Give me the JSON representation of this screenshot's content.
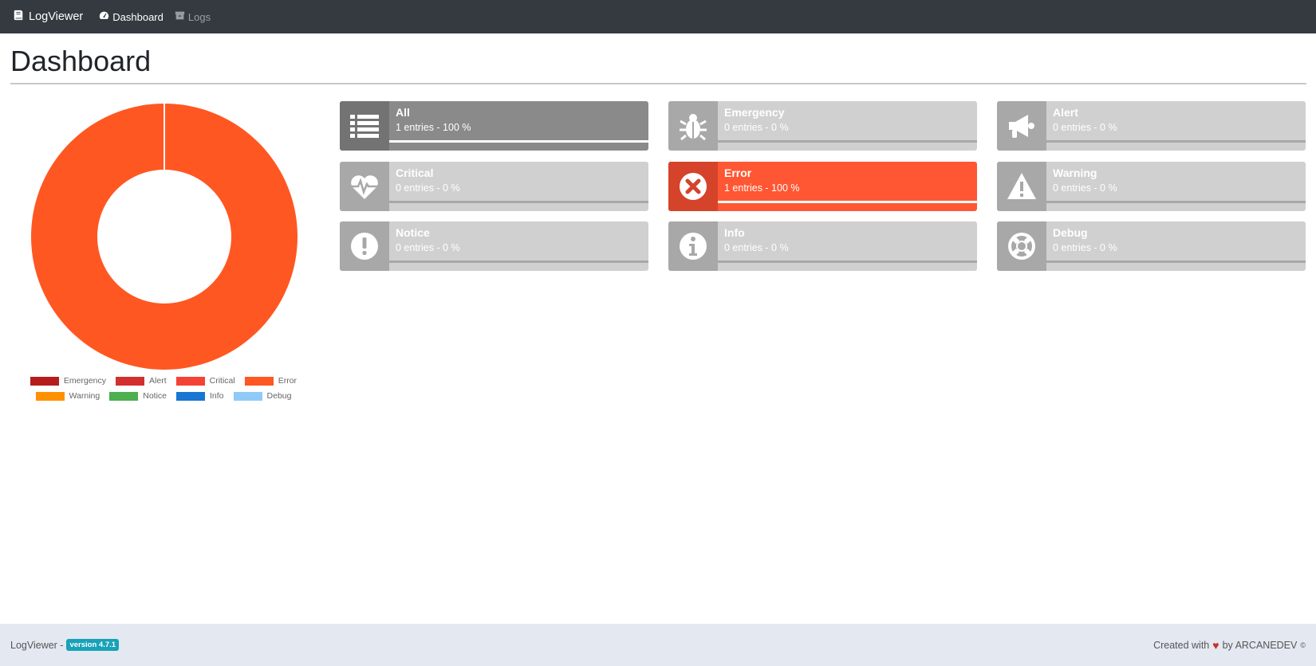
{
  "navbar": {
    "brand": "LogViewer",
    "links": [
      {
        "label": "Dashboard",
        "icon": "tachometer-icon",
        "active": true
      },
      {
        "label": "Logs",
        "icon": "archive-icon",
        "active": false
      }
    ]
  },
  "page": {
    "title": "Dashboard"
  },
  "chart_data": {
    "type": "pie",
    "donut": true,
    "categories": [
      "Emergency",
      "Alert",
      "Critical",
      "Error",
      "Warning",
      "Notice",
      "Info",
      "Debug"
    ],
    "values": [
      0,
      0,
      0,
      1,
      0,
      0,
      0,
      0
    ],
    "colors": [
      "#b71c1c",
      "#d32f2f",
      "#f44336",
      "#ff5722",
      "#ff9100",
      "#4caf50",
      "#1976d2",
      "#90caf9"
    ],
    "legend_position": "bottom"
  },
  "levels": [
    {
      "key": "all",
      "name": "All",
      "stats": "1 entries - 100 %",
      "percent": 100,
      "icon": "list-icon",
      "state": "all"
    },
    {
      "key": "emergency",
      "name": "Emergency",
      "stats": "0 entries - 0 %",
      "percent": 0,
      "icon": "bug-icon",
      "state": "empty"
    },
    {
      "key": "alert",
      "name": "Alert",
      "stats": "0 entries - 0 %",
      "percent": 0,
      "icon": "bullhorn-icon",
      "state": "empty"
    },
    {
      "key": "critical",
      "name": "Critical",
      "stats": "0 entries - 0 %",
      "percent": 0,
      "icon": "heartbeat-icon",
      "state": "empty"
    },
    {
      "key": "error",
      "name": "Error",
      "stats": "1 entries - 100 %",
      "percent": 100,
      "icon": "times-circle-icon",
      "state": "error"
    },
    {
      "key": "warning",
      "name": "Warning",
      "stats": "0 entries - 0 %",
      "percent": 0,
      "icon": "exclamation-triangle-icon",
      "state": "empty"
    },
    {
      "key": "notice",
      "name": "Notice",
      "stats": "0 entries - 0 %",
      "percent": 0,
      "icon": "exclamation-circle-icon",
      "state": "empty"
    },
    {
      "key": "info",
      "name": "Info",
      "stats": "0 entries - 0 %",
      "percent": 0,
      "icon": "info-circle-icon",
      "state": "empty"
    },
    {
      "key": "debug",
      "name": "Debug",
      "stats": "0 entries - 0 %",
      "percent": 0,
      "icon": "life-ring-icon",
      "state": "empty"
    }
  ],
  "footer": {
    "left_text": "LogViewer -",
    "version": "version 4.7.1",
    "right_prefix": "Created with",
    "right_suffix": "by ARCANEDEV",
    "copyright": "©"
  }
}
